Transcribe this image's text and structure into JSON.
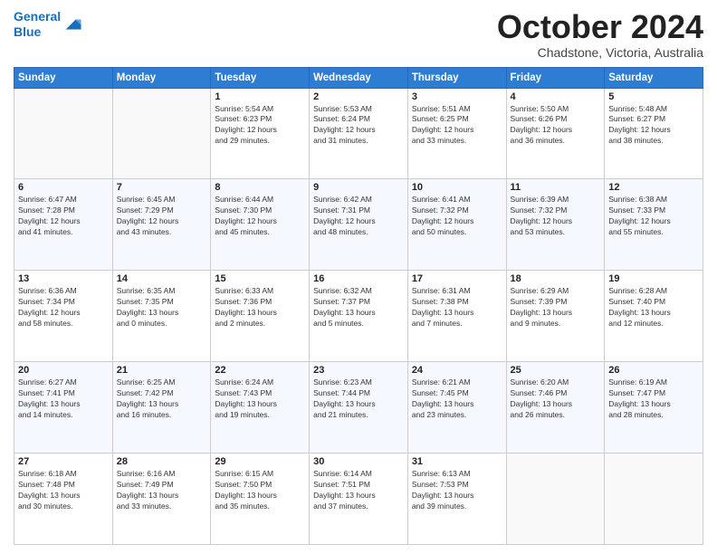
{
  "logo": {
    "line1": "General",
    "line2": "Blue",
    "icon_color": "#1a6fba"
  },
  "title": {
    "month_year": "October 2024",
    "location": "Chadstone, Victoria, Australia"
  },
  "weekdays": [
    "Sunday",
    "Monday",
    "Tuesday",
    "Wednesday",
    "Thursday",
    "Friday",
    "Saturday"
  ],
  "weeks": [
    [
      {
        "day": "",
        "info": ""
      },
      {
        "day": "",
        "info": ""
      },
      {
        "day": "1",
        "info": "Sunrise: 5:54 AM\nSunset: 6:23 PM\nDaylight: 12 hours\nand 29 minutes."
      },
      {
        "day": "2",
        "info": "Sunrise: 5:53 AM\nSunset: 6:24 PM\nDaylight: 12 hours\nand 31 minutes."
      },
      {
        "day": "3",
        "info": "Sunrise: 5:51 AM\nSunset: 6:25 PM\nDaylight: 12 hours\nand 33 minutes."
      },
      {
        "day": "4",
        "info": "Sunrise: 5:50 AM\nSunset: 6:26 PM\nDaylight: 12 hours\nand 36 minutes."
      },
      {
        "day": "5",
        "info": "Sunrise: 5:48 AM\nSunset: 6:27 PM\nDaylight: 12 hours\nand 38 minutes."
      }
    ],
    [
      {
        "day": "6",
        "info": "Sunrise: 6:47 AM\nSunset: 7:28 PM\nDaylight: 12 hours\nand 41 minutes."
      },
      {
        "day": "7",
        "info": "Sunrise: 6:45 AM\nSunset: 7:29 PM\nDaylight: 12 hours\nand 43 minutes."
      },
      {
        "day": "8",
        "info": "Sunrise: 6:44 AM\nSunset: 7:30 PM\nDaylight: 12 hours\nand 45 minutes."
      },
      {
        "day": "9",
        "info": "Sunrise: 6:42 AM\nSunset: 7:31 PM\nDaylight: 12 hours\nand 48 minutes."
      },
      {
        "day": "10",
        "info": "Sunrise: 6:41 AM\nSunset: 7:32 PM\nDaylight: 12 hours\nand 50 minutes."
      },
      {
        "day": "11",
        "info": "Sunrise: 6:39 AM\nSunset: 7:32 PM\nDaylight: 12 hours\nand 53 minutes."
      },
      {
        "day": "12",
        "info": "Sunrise: 6:38 AM\nSunset: 7:33 PM\nDaylight: 12 hours\nand 55 minutes."
      }
    ],
    [
      {
        "day": "13",
        "info": "Sunrise: 6:36 AM\nSunset: 7:34 PM\nDaylight: 12 hours\nand 58 minutes."
      },
      {
        "day": "14",
        "info": "Sunrise: 6:35 AM\nSunset: 7:35 PM\nDaylight: 13 hours\nand 0 minutes."
      },
      {
        "day": "15",
        "info": "Sunrise: 6:33 AM\nSunset: 7:36 PM\nDaylight: 13 hours\nand 2 minutes."
      },
      {
        "day": "16",
        "info": "Sunrise: 6:32 AM\nSunset: 7:37 PM\nDaylight: 13 hours\nand 5 minutes."
      },
      {
        "day": "17",
        "info": "Sunrise: 6:31 AM\nSunset: 7:38 PM\nDaylight: 13 hours\nand 7 minutes."
      },
      {
        "day": "18",
        "info": "Sunrise: 6:29 AM\nSunset: 7:39 PM\nDaylight: 13 hours\nand 9 minutes."
      },
      {
        "day": "19",
        "info": "Sunrise: 6:28 AM\nSunset: 7:40 PM\nDaylight: 13 hours\nand 12 minutes."
      }
    ],
    [
      {
        "day": "20",
        "info": "Sunrise: 6:27 AM\nSunset: 7:41 PM\nDaylight: 13 hours\nand 14 minutes."
      },
      {
        "day": "21",
        "info": "Sunrise: 6:25 AM\nSunset: 7:42 PM\nDaylight: 13 hours\nand 16 minutes."
      },
      {
        "day": "22",
        "info": "Sunrise: 6:24 AM\nSunset: 7:43 PM\nDaylight: 13 hours\nand 19 minutes."
      },
      {
        "day": "23",
        "info": "Sunrise: 6:23 AM\nSunset: 7:44 PM\nDaylight: 13 hours\nand 21 minutes."
      },
      {
        "day": "24",
        "info": "Sunrise: 6:21 AM\nSunset: 7:45 PM\nDaylight: 13 hours\nand 23 minutes."
      },
      {
        "day": "25",
        "info": "Sunrise: 6:20 AM\nSunset: 7:46 PM\nDaylight: 13 hours\nand 26 minutes."
      },
      {
        "day": "26",
        "info": "Sunrise: 6:19 AM\nSunset: 7:47 PM\nDaylight: 13 hours\nand 28 minutes."
      }
    ],
    [
      {
        "day": "27",
        "info": "Sunrise: 6:18 AM\nSunset: 7:48 PM\nDaylight: 13 hours\nand 30 minutes."
      },
      {
        "day": "28",
        "info": "Sunrise: 6:16 AM\nSunset: 7:49 PM\nDaylight: 13 hours\nand 33 minutes."
      },
      {
        "day": "29",
        "info": "Sunrise: 6:15 AM\nSunset: 7:50 PM\nDaylight: 13 hours\nand 35 minutes."
      },
      {
        "day": "30",
        "info": "Sunrise: 6:14 AM\nSunset: 7:51 PM\nDaylight: 13 hours\nand 37 minutes."
      },
      {
        "day": "31",
        "info": "Sunrise: 6:13 AM\nSunset: 7:53 PM\nDaylight: 13 hours\nand 39 minutes."
      },
      {
        "day": "",
        "info": ""
      },
      {
        "day": "",
        "info": ""
      }
    ]
  ]
}
